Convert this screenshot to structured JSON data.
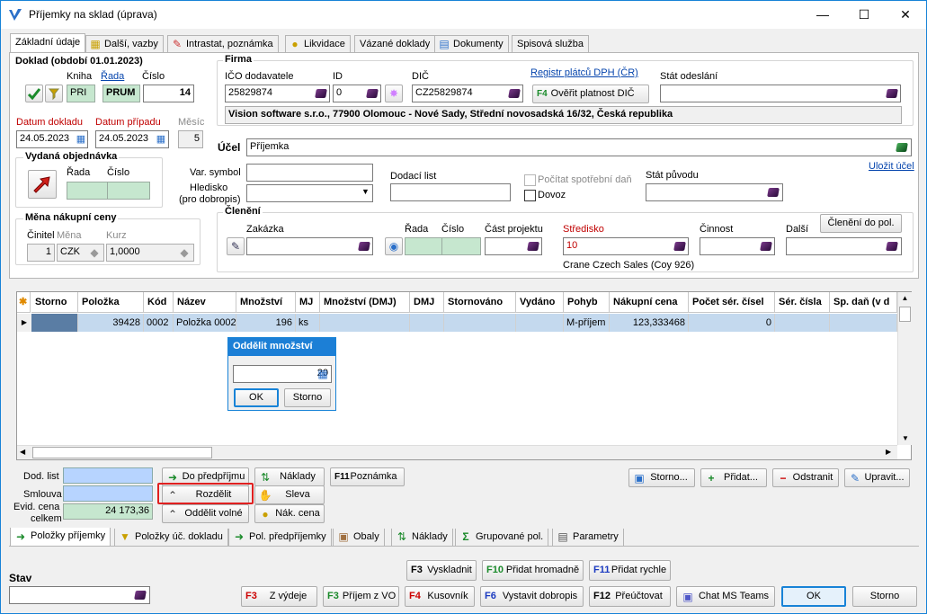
{
  "window": {
    "title": "Příjemky na sklad (úprava)",
    "minimize": "—",
    "maximize": "☐",
    "close": "✕"
  },
  "tabs": [
    "Základní údaje",
    "Další, vazby",
    "Intrastat, poznámka",
    "Likvidace",
    "Vázané doklady",
    "Dokumenty",
    "Spisová služba"
  ],
  "doklad": {
    "group_title": "Doklad (období 01.01.2023)",
    "kniha_label": "Kniha",
    "rada_label": "Řada",
    "cislo_label": "Číslo",
    "kniha": "PRI",
    "rada": "PRUM",
    "cislo": "14",
    "datum_dokladu_label": "Datum dokladu",
    "datum_pripadu_label": "Datum případu",
    "mesic_label": "Měsíc",
    "datum_dokladu": "24.05.2023",
    "datum_pripadu": "24.05.2023",
    "mesic": "5"
  },
  "objednavka": {
    "group_title": "Vydaná objednávka",
    "rada_label": "Řada",
    "cislo_label": "Číslo"
  },
  "mena": {
    "group_title": "Měna nákupní ceny",
    "cinitel_label": "Činitel",
    "mena_label": "Měna",
    "kurz_label": "Kurz",
    "cinitel": "1",
    "mena": "CZK",
    "kurz": "1,0000"
  },
  "firma": {
    "group_title": "Firma",
    "ico_label": "IČO dodavatele",
    "id_label": "ID",
    "dic_label": "DIČ",
    "registr_link": "Registr plátců DPH (ČR)",
    "stat_label": "Stát odeslání",
    "ico": "25829874",
    "id": "0",
    "dic": "CZ25829874",
    "overit_button": "Ověřit platnost DIČ",
    "overit_key": "F4",
    "address": "Vision software s.r.o., 77900 Olomouc - Nové Sady, Střední novosadská 16/32, Česká republika"
  },
  "ucel": {
    "label": "Účel",
    "value": "Příjemka",
    "save_link": "Uložit účel"
  },
  "misc": {
    "var_symbol_label": "Var. symbol",
    "hledisko_label": "Hledisko",
    "hledisko_sub": "(pro dobropis)",
    "dodaci_list_label": "Dodací list",
    "pocitat_label": "Počítat spotřební daň",
    "dovoz_label": "Dovoz",
    "stat_puvodu_label": "Stát původu"
  },
  "cleneni": {
    "group_title": "Členění",
    "zakazka_label": "Zakázka",
    "rada_label": "Řada",
    "cislo_label": "Číslo",
    "cast_projektu_label": "Část projektu",
    "stredisko_label": "Středisko",
    "cinnost_label": "Činnost",
    "dalsi_label": "Další",
    "cleneni_button": "Členění do pol.",
    "stredisko": "10",
    "stredisko_name": "Crane Czech Sales (Coy 926)"
  },
  "grid": {
    "columns": [
      "Storno",
      "Položka",
      "Kód",
      "Název",
      "Množství",
      "MJ",
      "Množství (DMJ)",
      "DMJ",
      "Stornováno",
      "Vydáno",
      "Pohyb",
      "Nákupní cena",
      "Počet sér. čísel",
      "Sér. čísla",
      "Sp. daň (v d"
    ],
    "rows": [
      {
        "storno": "",
        "polozka": "39428",
        "kod": "0002",
        "nazev": "Položka 0002",
        "mnozstvi": "196",
        "mj": "ks",
        "mnozstvi_dmj": "",
        "dmj": "",
        "stornovano": "",
        "vydano": "",
        "pohyb": "M-příjem",
        "cena": "123,333468",
        "pocet_ser": "0",
        "ser_cisla": "",
        "sp_dan": ""
      }
    ]
  },
  "popup": {
    "title": "Oddělit množství",
    "value": "20",
    "ok": "OK",
    "cancel": "Storno"
  },
  "bottom": {
    "dod_list_label": "Dod. list",
    "smlouva_label": "Smlouva",
    "evid_label_1": "Evid. cena",
    "evid_label_2": "celkem",
    "evid_value": "24 173,36",
    "do_predprijmu": "Do předpříjmu",
    "rozdelit": "Rozdělit",
    "oddelit_volne": "Oddělit volné",
    "naklady": "Náklady",
    "sleva": "Sleva",
    "nak_cena": "Nák. cena",
    "poznamka": "Poznámka",
    "poznamka_key": "F11",
    "storno": "Storno...",
    "pridat": "Přidat...",
    "odstranit": "Odstranit",
    "upravit": "Upravit..."
  },
  "bottom_tabs": [
    "Položky příjemky",
    "Položky úč. dokladu",
    "Pol. předpříjemky",
    "Obaly",
    "Náklady",
    "Grupované pol.",
    "Parametry"
  ],
  "footer": {
    "stav_label": "Stav",
    "vyskladnit": "Vyskladnit",
    "vyskladnit_key": "F3",
    "pridat_hromadne": "Přidat hromadně",
    "pridat_hromadne_key": "F10",
    "pridat_rychle": "Přidat rychle",
    "pridat_rychle_key": "F11",
    "z_vydeje": "Z výdeje",
    "z_vydeje_key": "F3",
    "prijem_z_vo": "Příjem z VO",
    "prijem_z_vo_key": "F3",
    "kusovnik": "Kusovník",
    "kusovnik_key": "F4",
    "vystavit_dobropis": "Vystavit dobropis",
    "vystavit_dobropis_key": "F6",
    "preuctovat": "Přeúčtovat",
    "preuctovat_key": "F12",
    "chat": "Chat MS Teams",
    "ok": "OK",
    "storno": "Storno"
  }
}
